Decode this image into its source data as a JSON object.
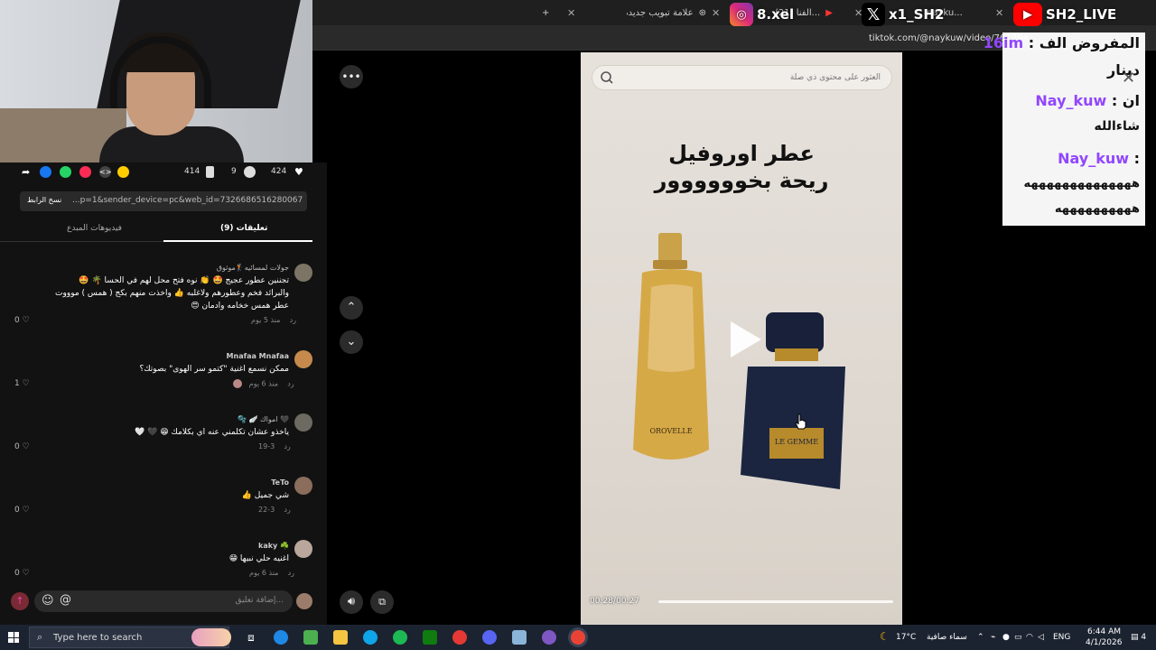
{
  "browser": {
    "tabs": [
      {
        "label": "علامة تبويب جديدة"
      },
      {
        "label": "(21) الفنا..."
      },
      {
        "label": "Nay_kuw (@naykuw)..."
      },
      {
        "label": "nayku..."
      }
    ],
    "new_tab": "+",
    "url": "tiktok.com/@naykuw/video/761794..."
  },
  "overlays": {
    "instagram": "8.xel",
    "x": "x1_SH2",
    "youtube": "SH2_LIVE"
  },
  "chat": {
    "lines": [
      {
        "user": "16im",
        "text": "المفروض الف"
      },
      {
        "user": "",
        "text": "دينار"
      },
      {
        "user": "Nay_kuw",
        "text": "ان"
      },
      {
        "user": "",
        "text": "شاءالله"
      },
      {
        "user": "Nay_kuw",
        "text": ""
      },
      {
        "user": "",
        "text": "ههههههههههههههه"
      },
      {
        "user": "",
        "text": "ههههههههههه"
      }
    ],
    "close": "✕"
  },
  "actions": {
    "likes": "424",
    "comments": "9",
    "saves": "414"
  },
  "link": {
    "copy_label": "نسخ الرابط",
    "value": "...p=1&sender_device=pc&web_id=7326686516280067592"
  },
  "tabs": {
    "comments": "(9) تعليقات",
    "creator_videos": "فيديوهات المبدع"
  },
  "comments": [
    {
      "name": "جولات لمسائيه🏌️موثوق",
      "text": "تجننين عطور عجيج 🤩 👏 نوه فتح محل لهم في الحسا 🌴 🤩 والبرائد فخم وعطورهم ولاغلبه 👍 واخذت منهم بكج ( همس ) موووت عطر همس خخامه وادمان 😍",
      "time": "منذ 5 يوم",
      "reply": "رد",
      "likes": "0"
    },
    {
      "name": "Mnafaa Mnafaa",
      "text": "ممكن نسمع اغنية \"كتمو سر الهوى\" بصوتك؟",
      "time": "منذ 6 يوم",
      "reply": "رد",
      "likes": "1"
    },
    {
      "name": "🫧 🪽 امواك 🖤",
      "text": "ياخذو عشان تكلمني عنه اي بكلامك 😁 🖤 🤍",
      "time": "3-19",
      "reply": "رد",
      "likes": "0"
    },
    {
      "name": "TeTo",
      "text": "شي جميل 👍",
      "time": "3-22",
      "reply": "رد",
      "likes": "0"
    },
    {
      "name": "kaky ☘️",
      "text": "اغنيه حلي نبيها 😁",
      "time": "منذ 6 يوم",
      "reply": "رد",
      "likes": "0"
    }
  ],
  "input": {
    "placeholder": "إضافة تعليق..."
  },
  "video": {
    "search_placeholder": "العثور على محتوى ذي صلة",
    "title_line1": "عطر اوروفيل",
    "title_line2": "ريحة بخوووووور",
    "bottle1_label": "OROVELLE",
    "bottle2_label": "LE GEMME",
    "timestamp": "00:28/00:27",
    "progress": 1.0
  },
  "taskbar": {
    "search_placeholder": "Type here to search",
    "weather": "17°C",
    "weather_text": "سماء صافية",
    "lang": "ENG",
    "time": "6:44 AM",
    "date": "4/1/2026",
    "notifications": "4"
  },
  "colors": {
    "accent_pink": "#fe2c55",
    "chat_name": "#9146ff"
  }
}
